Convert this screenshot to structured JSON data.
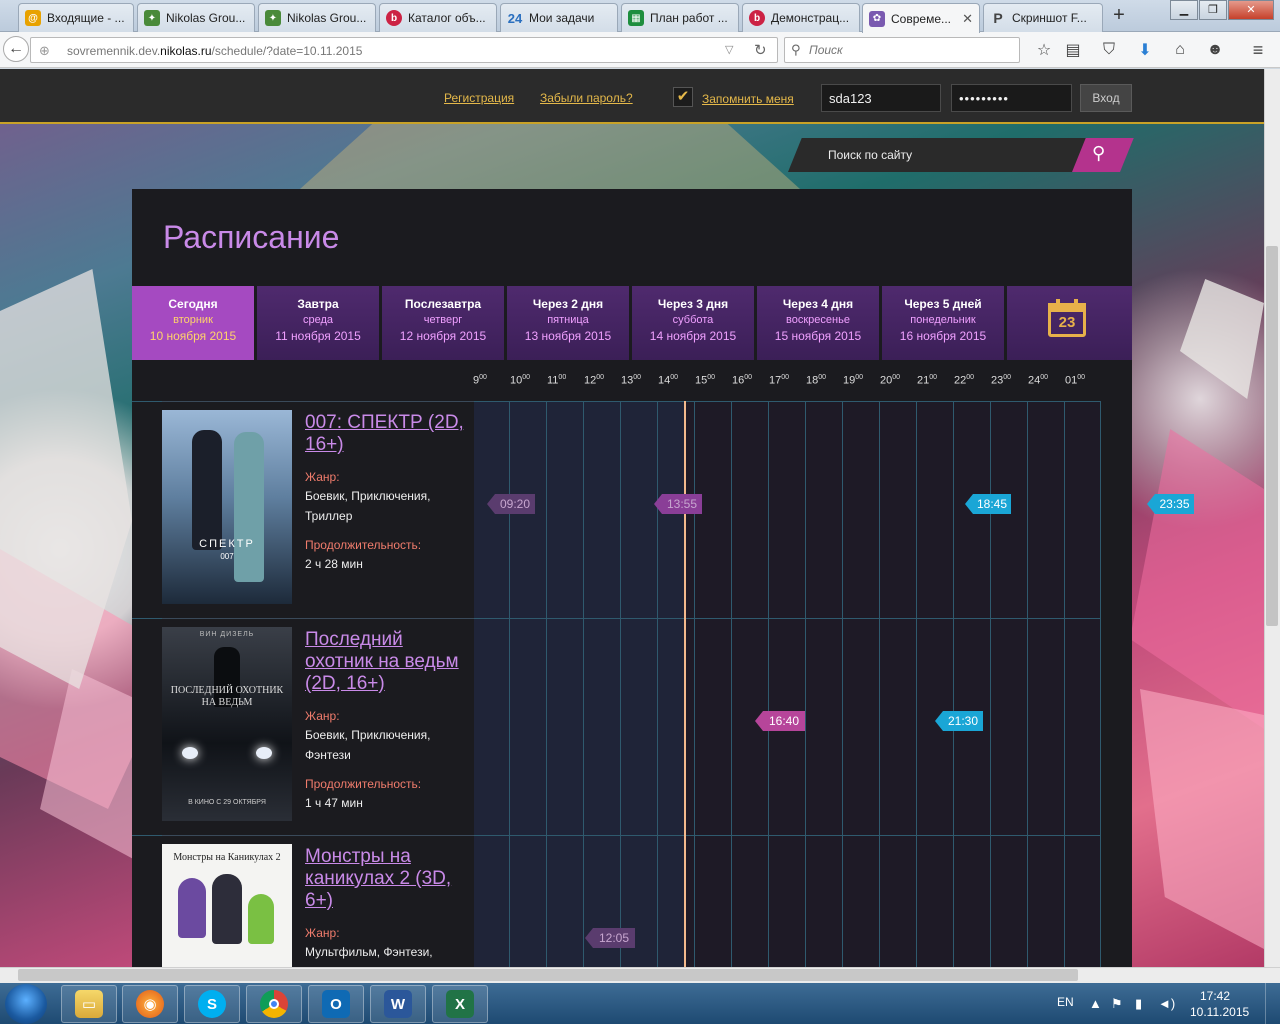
{
  "browser": {
    "tabs": [
      {
        "label": "Входящие - ...",
        "icon": "mail-icon",
        "color": "#e8a200"
      },
      {
        "label": "Nikolas Grou...",
        "icon": "puzzle-icon",
        "color": "#4a8a3a"
      },
      {
        "label": "Nikolas Grou...",
        "icon": "puzzle-icon",
        "color": "#4a8a3a"
      },
      {
        "label": "Каталог объ...",
        "icon": "b-icon",
        "color": "#cc2244"
      },
      {
        "label": "Мои задачи",
        "icon": "b24-icon",
        "color": "#2a6fbf"
      },
      {
        "label": "План работ ...",
        "icon": "sheet-icon",
        "color": "#1e8e3e"
      },
      {
        "label": "Демонстрац...",
        "icon": "b-icon",
        "color": "#cc2244"
      },
      {
        "label": "Совреме...",
        "icon": "site-icon",
        "color": "#7a5ab0"
      },
      {
        "label": "Скриншот F...",
        "icon": "p-icon",
        "color": "#555555"
      }
    ],
    "url_prefix": "sovremennik.dev.",
    "url_domain": "nikolas.ru",
    "url_suffix": "/schedule/?date=10.11.2015",
    "search_placeholder": "Поиск"
  },
  "topbar": {
    "register": "Регистрация",
    "forgot": "Забыли пароль?",
    "remember": "Запомнить меня",
    "login_value": "sda123",
    "password_value": "•••••••••",
    "login_button": "Вход"
  },
  "site_search": {
    "placeholder": "Поиск по сайту"
  },
  "schedule": {
    "title": "Расписание",
    "days": [
      {
        "line1": "Сегодня",
        "line2": "вторник",
        "line3": "10 ноября 2015"
      },
      {
        "line1": "Завтра",
        "line2": "среда",
        "line3": "11 ноября 2015"
      },
      {
        "line1": "Послезавтра",
        "line2": "четверг",
        "line3": "12 ноября 2015"
      },
      {
        "line1": "Через 2 дня",
        "line2": "пятница",
        "line3": "13 ноября 2015"
      },
      {
        "line1": "Через 3 дня",
        "line2": "суббота",
        "line3": "14 ноября 2015"
      },
      {
        "line1": "Через 4 дня",
        "line2": "воскресенье",
        "line3": "15 ноября 2015"
      },
      {
        "line1": "Через 5 дней",
        "line2": "понедельник",
        "line3": "16 ноября 2015"
      }
    ],
    "calendar_day": "23",
    "hours": [
      "9",
      "10",
      "11",
      "12",
      "13",
      "14",
      "15",
      "16",
      "17",
      "18",
      "19",
      "20",
      "21",
      "22",
      "23",
      "24",
      "01"
    ],
    "hour_suffix": "00",
    "movies": [
      {
        "title": "007: СПЕКТР (2D, 16+)",
        "genre_label": "Жанр:",
        "genre": "Боевик, Приключения, Триллер",
        "duration_label": "Продолжительность:",
        "duration": "2 ч 28 мин",
        "poster_text": "СПЕКТР",
        "poster_sub": "007",
        "sessions": [
          {
            "time": "09:20",
            "state": "past"
          },
          {
            "time": "13:55",
            "state": "past"
          },
          {
            "time": "18:45",
            "state": "upcoming"
          },
          {
            "time": "23:35",
            "state": "upcoming"
          }
        ]
      },
      {
        "title": "Последний охотник на ведьм (2D, 16+)",
        "genre_label": "Жанр:",
        "genre": "Боевик, Приключения, Фэнтези",
        "duration_label": "Продолжительность:",
        "duration": "1 ч 47 мин",
        "poster_top": "ВИН ДИЗЕЛЬ",
        "poster_text": "ПОСЛЕДНИЙ ОХОТНИК НА ВЕДЬМ",
        "poster_sub": "В КИНО С 29 ОКТЯБРЯ",
        "sessions": [
          {
            "time": "16:40",
            "state": "today"
          },
          {
            "time": "21:30",
            "state": "upcoming"
          }
        ]
      },
      {
        "title": "Монстры на каникулах 2 (3D, 6+)",
        "genre_label": "Жанр:",
        "genre": "Мультфильм, Фэнтези,",
        "poster_text": "Монстры на Каникулах 2",
        "sessions": [
          {
            "time": "12:05",
            "state": "past"
          }
        ]
      }
    ]
  },
  "taskbar": {
    "lang": "EN",
    "time": "17:42",
    "date": "10.11.2015",
    "apps": [
      "explorer",
      "firefox",
      "skype",
      "chrome",
      "outlook",
      "word",
      "excel"
    ]
  }
}
